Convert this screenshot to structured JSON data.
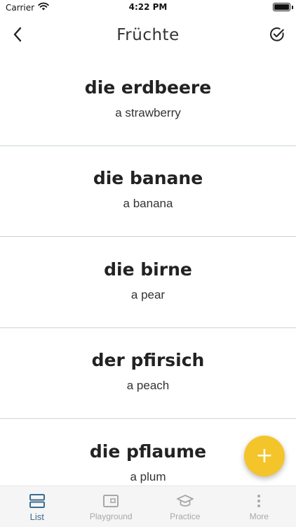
{
  "status_bar": {
    "carrier": "Carrier",
    "time": "4:22 PM",
    "battery_level": 1.0,
    "icons": [
      "wifi-icon",
      "battery-icon"
    ]
  },
  "nav": {
    "title": "Früchte",
    "back_icon": "chevron-left-icon",
    "check_icon": "check-circle-icon"
  },
  "words": [
    {
      "term": "die erdbeere",
      "translation": "a strawberry"
    },
    {
      "term": "die banane",
      "translation": "a banana"
    },
    {
      "term": "die birne",
      "translation": "a pear"
    },
    {
      "term": "der pfirsich",
      "translation": "a peach"
    },
    {
      "term": "die pflaume",
      "translation": "a plum"
    }
  ],
  "fab": {
    "label": "+",
    "color": "#f3c52b",
    "icon": "plus-icon"
  },
  "tabs": [
    {
      "label": "List",
      "icon": "list-icon",
      "active": true
    },
    {
      "label": "Playground",
      "icon": "picture-frame-icon",
      "active": false
    },
    {
      "label": "Practice",
      "icon": "graduation-cap-icon",
      "active": false
    },
    {
      "label": "More",
      "icon": "more-vertical-icon",
      "active": false
    }
  ],
  "colors": {
    "accent": "#3a6d8f",
    "divider": "#c9d6d2",
    "inactive": "#a8a8a8"
  }
}
